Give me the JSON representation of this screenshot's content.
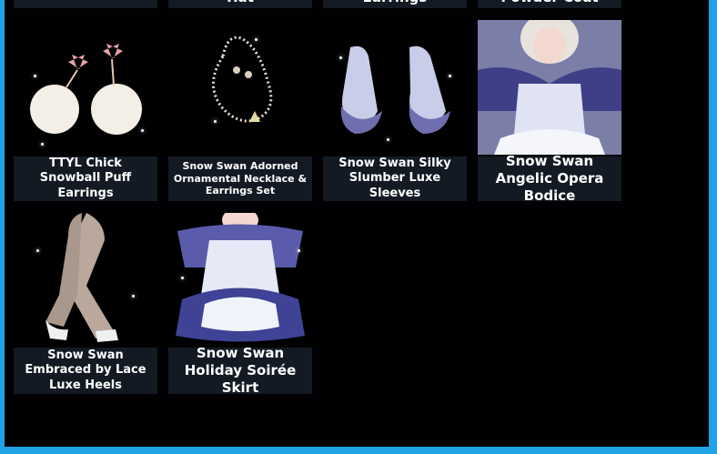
{
  "top_row_partial": [
    {
      "name": ""
    },
    {
      "name": "Hat"
    },
    {
      "name": "Earrings"
    },
    {
      "name": "Powder Coat"
    }
  ],
  "items": [
    {
      "name": "TTYL Chick Snowball Puff Earrings",
      "icon": "snowball-earrings-icon"
    },
    {
      "name": "Snow Swan Adorned Ornamental Necklace & Earrings Set",
      "icon": "necklace-icon"
    },
    {
      "name": "Snow Swan Silky Slumber Luxe Sleeves",
      "icon": "sleeves-icon"
    },
    {
      "name": "Snow Swan Angelic Opera Bodice",
      "icon": "bodice-icon"
    },
    {
      "name": "Snow Swan Embraced by Lace Luxe Heels",
      "icon": "heels-icon"
    },
    {
      "name": "Snow Swan Holiday Soirée Skirt",
      "icon": "skirt-icon"
    }
  ],
  "colors": {
    "frame_border": "#1fa3e6",
    "background": "#010103",
    "label_background": "#141a24",
    "label_text": "#ffffff"
  }
}
